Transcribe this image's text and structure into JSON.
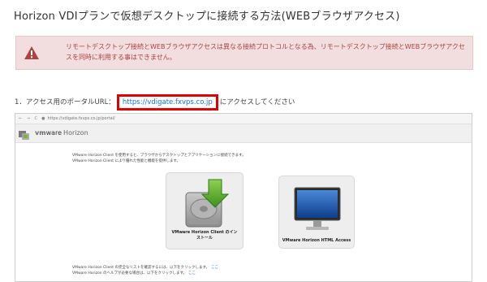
{
  "page": {
    "title": "Horizon VDIプランで仮想デスクトップに接続する方法(WEBブラウザアクセス)"
  },
  "warning": {
    "text": "リモートデスクトップ接続とWEBブラウザアクセスは異なる接続プロトコルとなる為、リモートデスクトップ接続とWEBブラウザアクセスを同時に利用する事はできません。",
    "icon": "warning-triangle-icon",
    "background_color": "#f2dede",
    "text_color": "#a94442",
    "icon_color": "#a94442"
  },
  "step1": {
    "prefix": "1．アクセス用のポータルURL：",
    "url": "https://vdigate.fxvps.co.jp",
    "suffix": "にアクセスしてください",
    "highlight_color": "#e00000"
  },
  "browser": {
    "nav_icons": "← → C",
    "address": "https://vdigate.fxvps.co.jp/portal/",
    "brand_vm": "vm",
    "brand_ware": "ware",
    "product": "Horizon",
    "intro_line1": "VMware Horizon Client を使用すると、ブラウザからデスクトップとアプリケーションに接続できます。",
    "intro_line2": "VMware Horizon Client により優れた性能と機能を提供します。",
    "tile_client_label_1": "VMware Horizon Client のイン",
    "tile_client_label_2": "ストール",
    "tile_html_label": "VMware Horizon HTML Access",
    "footer_line1": "VMware Horizon Client の完全なリストを確認するには、以下をクリックします。",
    "footer_line2": "VMware Horizon のヘルプが必要な場合は、以下をクリックします。",
    "footer_link": "ここ"
  }
}
